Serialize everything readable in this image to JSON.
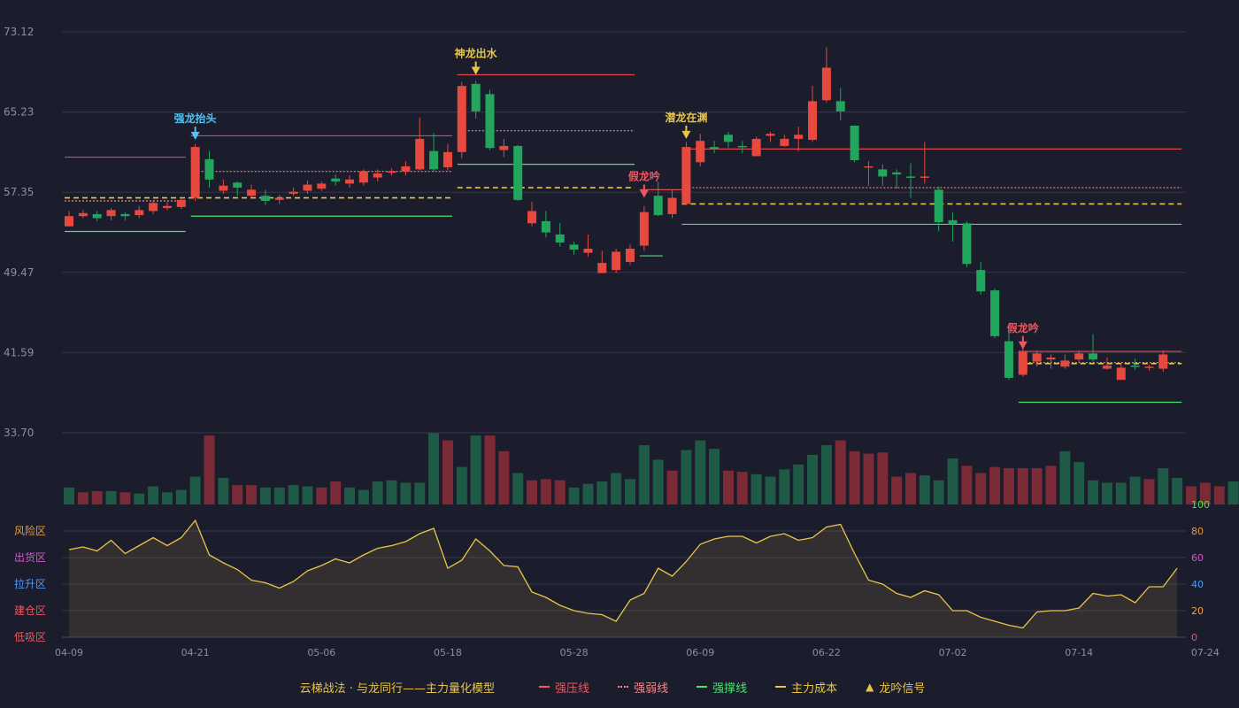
{
  "chart_data": {
    "type": "candlestick",
    "price_axis": {
      "ticks": [
        "73.12",
        "65.23",
        "57.35",
        "49.47",
        "41.59",
        "33.70"
      ],
      "ylim": [
        33.7,
        73.12
      ]
    },
    "volume": [
      14,
      10,
      11,
      11,
      10,
      9,
      15,
      10,
      12,
      23,
      57,
      22,
      16,
      16,
      14,
      14,
      16,
      15,
      14,
      19,
      14,
      12,
      19,
      20,
      18,
      18,
      59,
      53,
      31,
      57,
      57,
      44,
      26,
      20,
      21,
      20,
      14,
      17,
      19,
      26,
      21,
      49,
      37,
      28,
      45,
      53,
      46,
      28,
      27,
      25,
      23,
      29,
      33,
      41,
      49,
      53,
      44,
      42,
      43,
      23,
      26,
      24,
      20,
      38,
      32,
      26,
      31,
      30,
      30,
      30,
      32,
      44,
      35,
      20,
      18,
      18,
      23,
      21,
      30,
      22,
      15,
      18,
      15,
      19
    ],
    "volume_color": [
      "g",
      "r",
      "r",
      "g",
      "r",
      "g",
      "g",
      "g",
      "g",
      "g",
      "r",
      "g",
      "r",
      "r",
      "g",
      "g",
      "g",
      "g",
      "r",
      "r",
      "g",
      "g",
      "g",
      "g",
      "g",
      "g",
      "g",
      "r",
      "g",
      "g",
      "r",
      "r",
      "g",
      "r",
      "r",
      "r",
      "g",
      "g",
      "g",
      "g",
      "g",
      "g",
      "g",
      "r",
      "g",
      "g",
      "g",
      "r",
      "r",
      "g",
      "g",
      "g",
      "g",
      "g",
      "g",
      "r",
      "r",
      "r",
      "r",
      "r",
      "r",
      "g",
      "g",
      "g",
      "r",
      "r",
      "r",
      "r",
      "r",
      "r",
      "r",
      "g",
      "g",
      "g",
      "g",
      "g",
      "g",
      "r",
      "g",
      "g",
      "r",
      "r",
      "r",
      "g"
    ],
    "candles": [
      [
        54.0,
        55.0,
        55.5,
        54.0
      ],
      [
        55.0,
        55.3,
        55.6,
        54.8
      ],
      [
        55.2,
        54.8,
        55.5,
        54.5
      ],
      [
        55.0,
        55.6,
        55.8,
        54.6
      ],
      [
        55.2,
        55.0,
        55.4,
        54.6
      ],
      [
        55.1,
        55.6,
        56.0,
        54.8
      ],
      [
        55.5,
        56.3,
        56.6,
        55.2
      ],
      [
        55.8,
        56.0,
        56.4,
        55.6
      ],
      [
        55.9,
        56.6,
        56.8,
        55.7
      ],
      [
        56.8,
        61.8,
        62.1,
        56.5
      ],
      [
        60.6,
        58.6,
        61.4,
        57.8
      ],
      [
        57.5,
        58.0,
        58.6,
        57.2
      ],
      [
        58.3,
        57.8,
        58.4,
        57.0
      ],
      [
        57.0,
        57.6,
        58.1,
        56.8
      ],
      [
        57.0,
        56.5,
        57.6,
        56.1
      ],
      [
        56.6,
        56.8,
        57.1,
        56.2
      ],
      [
        57.2,
        57.4,
        57.8,
        57.0
      ],
      [
        57.5,
        58.1,
        58.5,
        57.2
      ],
      [
        57.7,
        58.2,
        58.4,
        57.5
      ],
      [
        58.7,
        58.4,
        59.1,
        58.0
      ],
      [
        58.2,
        58.6,
        59.0,
        57.8
      ],
      [
        58.3,
        59.4,
        59.6,
        58.0
      ],
      [
        58.8,
        59.2,
        59.6,
        58.4
      ],
      [
        59.3,
        59.4,
        59.7,
        59.0
      ],
      [
        59.4,
        59.9,
        60.4,
        59.0
      ],
      [
        59.6,
        62.6,
        64.7,
        59.5
      ],
      [
        61.4,
        59.6,
        63.2,
        59.4
      ],
      [
        59.8,
        61.3,
        62.1,
        59.5
      ],
      [
        61.3,
        67.8,
        68.2,
        60.7
      ],
      [
        68.0,
        65.3,
        68.3,
        64.6
      ],
      [
        67.0,
        61.7,
        67.4,
        61.5
      ],
      [
        61.5,
        61.9,
        62.6,
        60.8
      ],
      [
        61.9,
        56.6,
        62.0,
        56.5
      ],
      [
        54.3,
        55.5,
        56.4,
        54.0
      ],
      [
        54.5,
        53.4,
        55.5,
        52.9
      ],
      [
        53.2,
        52.4,
        54.3,
        52.0
      ],
      [
        52.2,
        51.7,
        52.5,
        51.2
      ],
      [
        51.4,
        51.8,
        53.2,
        51.0
      ],
      [
        49.4,
        50.4,
        51.6,
        49.4
      ],
      [
        49.7,
        51.5,
        51.8,
        49.4
      ],
      [
        50.5,
        51.8,
        52.2,
        50.2
      ],
      [
        52.1,
        55.4,
        56.0,
        51.6
      ],
      [
        57.0,
        55.1,
        58.4,
        55.0
      ],
      [
        55.2,
        56.8,
        57.6,
        54.8
      ],
      [
        56.2,
        61.8,
        62.3,
        56.1
      ],
      [
        60.3,
        62.4,
        63.1,
        59.9
      ],
      [
        61.8,
        61.6,
        62.4,
        61.2
      ],
      [
        63.0,
        62.3,
        63.3,
        61.7
      ],
      [
        61.9,
        61.8,
        62.4,
        61.2
      ],
      [
        60.9,
        62.6,
        62.8,
        60.9
      ],
      [
        62.9,
        63.1,
        63.3,
        62.3
      ],
      [
        61.9,
        62.6,
        63.0,
        61.8
      ],
      [
        62.6,
        63.0,
        63.8,
        61.4
      ],
      [
        62.5,
        66.3,
        67.8,
        62.3
      ],
      [
        66.4,
        69.6,
        71.6,
        66.2
      ],
      [
        66.3,
        65.3,
        67.6,
        64.4
      ],
      [
        63.9,
        60.5,
        63.9,
        60.3
      ],
      [
        59.9,
        59.9,
        60.4,
        58.0
      ],
      [
        59.6,
        58.9,
        60.1,
        58.0
      ],
      [
        59.3,
        59.1,
        59.6,
        57.7
      ],
      [
        58.9,
        58.8,
        60.2,
        56.8
      ],
      [
        58.8,
        58.9,
        62.3,
        58.2
      ],
      [
        57.6,
        54.4,
        57.9,
        53.5
      ],
      [
        54.6,
        54.2,
        55.4,
        52.5
      ],
      [
        54.3,
        50.3,
        54.5,
        50.0
      ],
      [
        49.7,
        47.6,
        50.5,
        47.3
      ],
      [
        47.7,
        43.2,
        47.9,
        43.0
      ],
      [
        42.7,
        39.1,
        43.8,
        38.9
      ],
      [
        39.4,
        41.7,
        42.0,
        39.2
      ],
      [
        40.7,
        41.5,
        41.8,
        40.2
      ],
      [
        40.9,
        41.1,
        41.4,
        40.0
      ],
      [
        40.2,
        40.8,
        41.4,
        40.0
      ],
      [
        40.9,
        41.5,
        41.8,
        40.6
      ],
      [
        41.5,
        40.9,
        43.4,
        40.7
      ],
      [
        40.0,
        40.3,
        41.1,
        39.9
      ],
      [
        38.9,
        40.1,
        40.5,
        38.9
      ],
      [
        40.3,
        40.2,
        41.0,
        39.9
      ],
      [
        40.2,
        40.2,
        40.4,
        39.8
      ],
      [
        40.0,
        41.4,
        41.8,
        39.7
      ]
    ],
    "signals": [
      {
        "idx": 9,
        "label": "强龙抬头",
        "color": "#4fc3f7",
        "pos": 62.5
      },
      {
        "idx": 29,
        "label": "神龙出水",
        "color": "#e8c547",
        "pos": 68.9
      },
      {
        "idx": 41,
        "label": "假龙吟",
        "color": "#f0575f",
        "pos": 56.8
      },
      {
        "idx": 44,
        "label": "潜龙在渊",
        "color": "#e8c547",
        "pos": 62.6
      },
      {
        "idx": 68,
        "label": "假龙吟",
        "color": "#f0575f",
        "pos": 41.9
      }
    ],
    "levels": {
      "strong_pressure": [
        [
          0,
          8,
          60.8
        ],
        [
          9,
          27,
          62.9
        ],
        [
          28,
          40,
          68.9
        ],
        [
          41,
          44,
          57.6
        ],
        [
          44,
          79,
          61.6
        ],
        [
          68,
          79,
          41.7
        ]
      ],
      "weak_pressure": [
        [
          0,
          8,
          56.5
        ],
        [
          9,
          27,
          59.4
        ],
        [
          28,
          40,
          63.4
        ],
        [
          44,
          79,
          57.8
        ],
        [
          68,
          79,
          40.6
        ]
      ],
      "support": [
        [
          0,
          8,
          53.5
        ],
        [
          9,
          27,
          55.0
        ],
        [
          28,
          40,
          60.1
        ],
        [
          41,
          42,
          51.1
        ],
        [
          44,
          79,
          54.2
        ],
        [
          68,
          79,
          36.7
        ]
      ],
      "main_cost": [
        [
          0,
          27,
          56.8
        ],
        [
          28,
          40,
          57.8
        ],
        [
          44,
          79,
          56.2
        ],
        [
          68,
          79,
          40.5
        ]
      ]
    },
    "indicator": {
      "values": [
        66,
        68,
        65,
        73,
        63,
        69,
        75,
        69,
        75,
        88,
        62,
        56,
        51,
        43,
        41,
        37,
        42,
        50,
        54,
        59,
        56,
        62,
        67,
        69,
        72,
        78,
        82,
        52,
        58,
        74,
        65,
        54,
        53,
        34,
        30,
        24,
        20,
        18,
        17,
        12,
        28,
        33,
        52,
        46,
        57,
        70,
        74,
        76,
        76,
        71,
        76,
        78,
        73,
        75,
        83,
        85,
        63,
        43,
        40,
        33,
        30,
        35,
        32,
        20,
        20,
        15,
        12,
        9,
        7,
        19,
        20,
        20,
        22,
        33,
        31,
        32,
        26,
        38,
        38,
        52
      ],
      "ylim": [
        0,
        100
      ],
      "right_ticks": [
        "100",
        "80",
        "60",
        "40",
        "20",
        "0"
      ],
      "right_tick_colors": [
        "#49e04f",
        "#e89a3a",
        "#d05bd0",
        "#4d9cf4",
        "#f0a24a",
        "#f0575f"
      ],
      "zones": [
        "风险区",
        "出货区",
        "拉升区",
        "建仓区",
        "低吸区"
      ],
      "zone_colors": [
        "#e89a3a",
        "#d05bd0",
        "#4d9cf4",
        "#f0575f",
        "#f0575f"
      ]
    },
    "x_ticks": [
      {
        "idx": 0,
        "label": "04-09"
      },
      {
        "idx": 9,
        "label": "04-21"
      },
      {
        "idx": 18,
        "label": "05-06"
      },
      {
        "idx": 27,
        "label": "05-18"
      },
      {
        "idx": 36,
        "label": "05-28"
      },
      {
        "idx": 45,
        "label": "06-09"
      },
      {
        "idx": 54,
        "label": "06-22"
      },
      {
        "idx": 63,
        "label": "07-02"
      },
      {
        "idx": 72,
        "label": "07-14"
      },
      {
        "idx": 81,
        "label": "07-24"
      }
    ],
    "legend": {
      "title": "云梯战法 · 与龙同行——主力量化模型",
      "items": [
        {
          "label": "强压线",
          "color": "#f0575f",
          "style": "solid"
        },
        {
          "label": "强弱线",
          "color": "#f08a8a",
          "style": "dotted"
        },
        {
          "label": "强撑线",
          "color": "#4ee06e",
          "style": "solid"
        },
        {
          "label": "主力成本",
          "color": "#e8c547",
          "style": "dashed"
        },
        {
          "label": "龙吟信号",
          "color": "#e8c547",
          "style": "triangle"
        }
      ]
    }
  }
}
